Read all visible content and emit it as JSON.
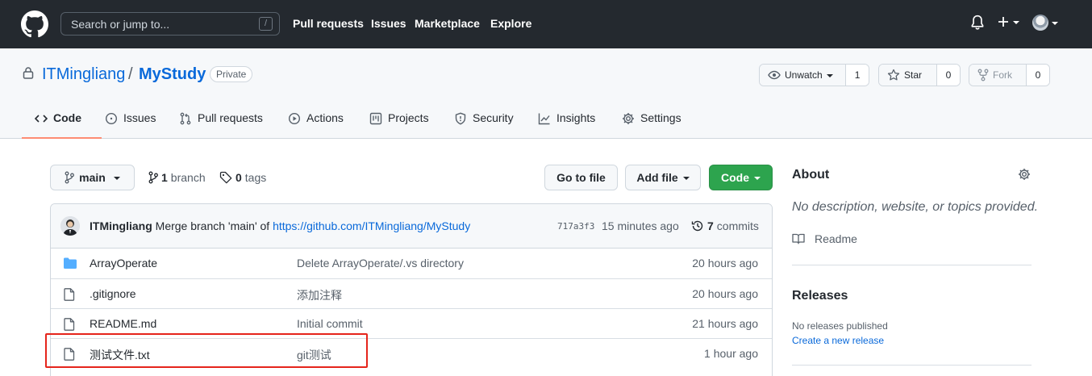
{
  "header": {
    "search_placeholder": "Search or jump to...",
    "search_shortcut": "/",
    "nav": [
      "Pull requests",
      "Issues",
      "Marketplace",
      "Explore"
    ]
  },
  "repo": {
    "owner": "ITMingliang",
    "separator": "/",
    "name": "MyStudy",
    "visibility": "Private",
    "watch_label": "Unwatch",
    "watch_count": "1",
    "star_label": "Star",
    "star_count": "0",
    "fork_label": "Fork",
    "fork_count": "0"
  },
  "tabs": [
    {
      "label": "Code",
      "icon": "code-icon"
    },
    {
      "label": "Issues",
      "icon": "issue-icon"
    },
    {
      "label": "Pull requests",
      "icon": "pull-request-icon"
    },
    {
      "label": "Actions",
      "icon": "play-icon"
    },
    {
      "label": "Projects",
      "icon": "project-icon"
    },
    {
      "label": "Security",
      "icon": "shield-icon"
    },
    {
      "label": "Insights",
      "icon": "graph-icon"
    },
    {
      "label": "Settings",
      "icon": "gear-icon"
    }
  ],
  "toolbar": {
    "branch": "main",
    "branch_count": "1",
    "branch_label": "branch",
    "tag_count": "0",
    "tag_label": "tags",
    "go_to_file": "Go to file",
    "add_file": "Add file",
    "code": "Code"
  },
  "latest_commit": {
    "author": "ITMingliang",
    "message_prefix": "Merge branch 'main' of",
    "message_link": "https://github.com/ITMingliang/MyStudy",
    "sha": "717a3f3",
    "time": "15 minutes ago",
    "commit_count": "7",
    "commit_label": "commits"
  },
  "files": [
    {
      "type": "directory",
      "name": "ArrayOperate",
      "message": "Delete ArrayOperate/.vs directory",
      "time": "20 hours ago"
    },
    {
      "type": "file",
      "name": ".gitignore",
      "message": "添加注释",
      "time": "20 hours ago"
    },
    {
      "type": "file",
      "name": "README.md",
      "message": "Initial commit",
      "time": "21 hours ago"
    },
    {
      "type": "file",
      "name": "测试文件.txt",
      "message": "git测试",
      "time": "1 hour ago"
    }
  ],
  "sidebar": {
    "about_title": "About",
    "about_desc": "No description, website, or topics provided.",
    "readme": "Readme",
    "releases_title": "Releases",
    "no_releases": "No releases published",
    "create_release": "Create a new release"
  },
  "colors": {
    "header_bg": "#24292f",
    "accent": "#0969da",
    "green": "#2da44e",
    "tab_underline": "#fd8c73",
    "highlight_box": "#e5251c"
  }
}
